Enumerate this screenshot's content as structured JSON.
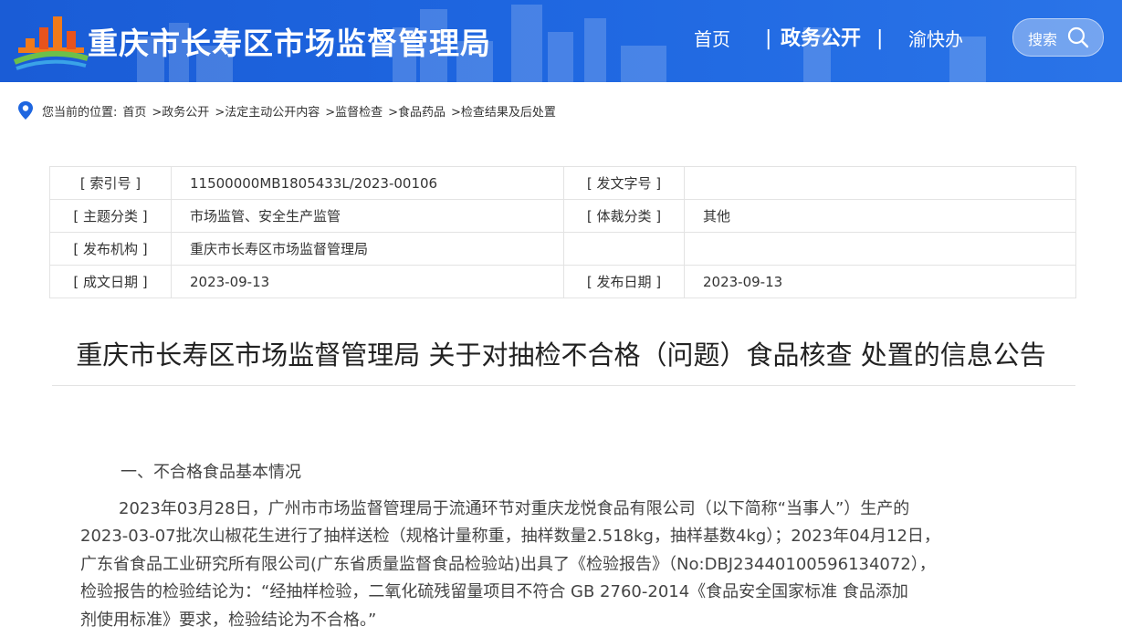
{
  "header": {
    "site_title": "重庆市长寿区市场监督管理局",
    "nav": [
      {
        "label": "首页"
      },
      {
        "label": "政务公开"
      },
      {
        "label": "渝快办"
      }
    ],
    "separator": "|",
    "search_label": "搜索",
    "colors": {
      "primary": "#1e66e0",
      "logo_orange": "#f07a1a",
      "logo_green": "#6cc04a"
    }
  },
  "breadcrumb": {
    "prefix": "您当前的位置:",
    "items": [
      "首页",
      ">政务公开",
      ">法定主动公开内容",
      ">监督检查",
      ">食品药品",
      ">检查结果及后处置"
    ]
  },
  "meta": {
    "rows": [
      {
        "l1": "[ 索引号 ]",
        "v1": "11500000MB1805433L/2023-00106",
        "l2": "[ 发文字号 ]",
        "v2": ""
      },
      {
        "l1": "[ 主题分类 ]",
        "v1": "市场监管、安全生产监管",
        "l2": "[ 体裁分类 ]",
        "v2": "其他"
      },
      {
        "l1": "[ 发布机构 ]",
        "v1": "重庆市长寿区市场监督管理局",
        "l2": "",
        "v2": ""
      },
      {
        "l1": "[ 成文日期 ]",
        "v1": "2023-09-13",
        "l2": "[ 发布日期 ]",
        "v2": "2023-09-13"
      }
    ]
  },
  "doc": {
    "title": "重庆市长寿区市场监督管理局 关于对抽检不合格（问题）食品核查 处置的信息公告",
    "section1_heading": "一、不合格食品基本情况",
    "lines": [
      "2023年03月28日，广州市市场监督管理局于流通环节对重庆龙悦食品有限公司（以下简称“当事人”）生产的",
      "2023-03-07批次山椒花生进行了抽样送检（规格计量称重，抽样数量2.518kg，抽样基数4kg）；2023年04月12日，",
      "广东省食品工业研究所有限公司(广东省质量监督食品检验站)出具了《检验报告》（No:DBJ23440100596134072），",
      "检验报告的检验结论为：“经抽样检验，二氧化硫残留量项目不符合 GB 2760-2014《食品安全国家标准 食品添加",
      "剂使用标准》要求，检验结论为不合格。”"
    ]
  }
}
